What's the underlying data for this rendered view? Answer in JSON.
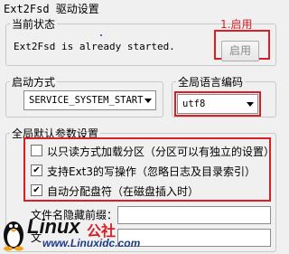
{
  "window": {
    "title": "Ext2Fsd 驱动设置"
  },
  "status_group": {
    "legend": "当前状态",
    "message": "Ext2Fsd is already started.",
    "start_button": "启用",
    "annotation": "1.启用"
  },
  "startup_group": {
    "legend": "启动方式",
    "selected": "SERVICE_SYSTEM_START"
  },
  "language_group": {
    "legend": "全局语言编码",
    "selected": "utf8"
  },
  "defaults_group": {
    "legend": "全局默认参数设置",
    "options": [
      {
        "label": "以只读方式加载分区（分区可以有独立的设置）",
        "checked": false
      },
      {
        "label": "支持Ext3的写操作（忽略日志及目录索引）",
        "checked": true
      },
      {
        "label": "自动分配盘符（在磁盘插入时）",
        "checked": true
      }
    ],
    "hidden_prefix_label": "文件名隐藏前缀：",
    "second_label": "文"
  },
  "watermark": {
    "brand": "Linux",
    "brand_suffix": "公社",
    "url": "www.Linuxidc.com"
  },
  "colors": {
    "accent_red": "#d91f26",
    "background": "#f0f0f0"
  }
}
